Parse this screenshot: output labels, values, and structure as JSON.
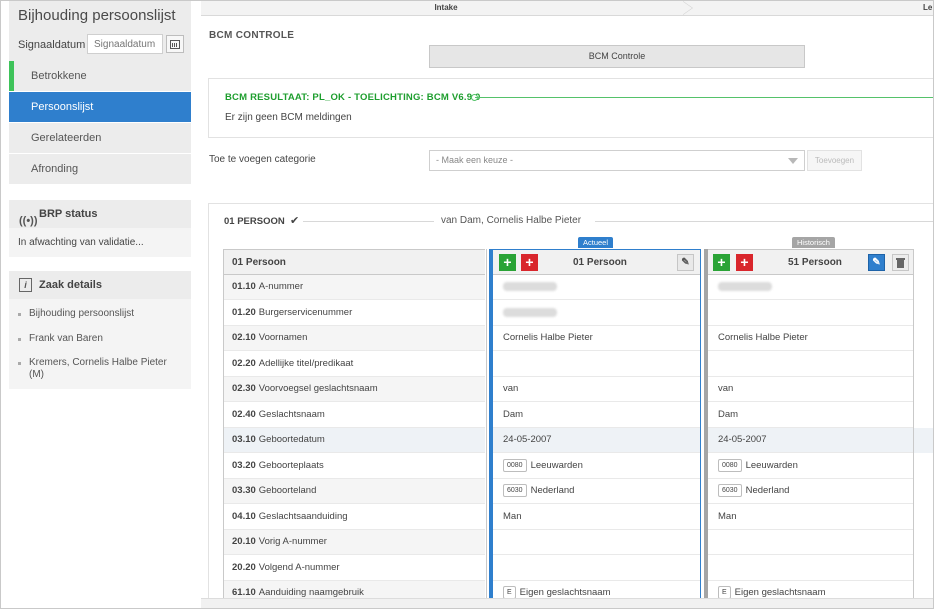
{
  "app": {
    "title": "Bijhouding persoonslijst"
  },
  "sidebar": {
    "signaaldatum_label": "Signaaldatum",
    "signaaldatum_placeholder": "Signaaldatum",
    "nav": [
      {
        "label": "Betrokkene",
        "state": "done"
      },
      {
        "label": "Persoonslijst",
        "state": "active"
      },
      {
        "label": "Gerelateerden",
        "state": "normal"
      },
      {
        "label": "Afronding",
        "state": "normal"
      }
    ],
    "brp": {
      "title": "BRP status",
      "text": "In afwachting van validatie..."
    },
    "zaak": {
      "title": "Zaak details",
      "items": [
        "Bijhouding persoonslijst",
        "Frank van Baren",
        "Kremers, Cornelis Halbe Pieter",
        "(M)"
      ]
    }
  },
  "steps": {
    "current": "Intake",
    "next": "Le"
  },
  "bcm": {
    "heading": "BCM CONTROLE",
    "button": "BCM Controle",
    "result_title": "BCM RESULTAAT: PL_OK - TOELICHTING: BCM V6.9.0",
    "result_text": "Er zijn geen BCM meldingen"
  },
  "category": {
    "label": "Toe te voegen categorie",
    "placeholder": "- Maak een keuze -",
    "add_button": "Toevoegen"
  },
  "persoon": {
    "title": "01 PERSOON",
    "name": "van Dam, Cornelis Halbe Pieter",
    "header_label": "01 Persoon",
    "actueel_tag": "Actueel",
    "actueel_header": "01 Persoon",
    "hist_tag": "Historisch",
    "hist_header": "51 Persoon",
    "rows": [
      {
        "code": "01.10",
        "label": "A-nummer",
        "act": "",
        "act_code": "",
        "hist": "",
        "hist_code": "",
        "redacted": true
      },
      {
        "code": "01.20",
        "label": "Burgerservicenummer",
        "act": "",
        "act_code": "",
        "hist": "",
        "hist_code": "",
        "redacted_act": true
      },
      {
        "code": "02.10",
        "label": "Voornamen",
        "act": "Cornelis Halbe Pieter",
        "act_code": "",
        "hist": "Cornelis Halbe Pieter",
        "hist_code": ""
      },
      {
        "code": "02.20",
        "label": "Adellijke titel/predikaat",
        "act": "",
        "act_code": "",
        "hist": "",
        "hist_code": ""
      },
      {
        "code": "02.30",
        "label": "Voorvoegsel geslachtsnaam",
        "act": "van",
        "act_code": "",
        "hist": "van",
        "hist_code": ""
      },
      {
        "code": "02.40",
        "label": "Geslachtsnaam",
        "act": "Dam",
        "act_code": "",
        "hist": "Dam",
        "hist_code": ""
      },
      {
        "code": "03.10",
        "label": "Geboortedatum",
        "act": "24-05-2007",
        "act_code": "",
        "hist": "24-05-2007",
        "hist_code": ""
      },
      {
        "code": "03.20",
        "label": "Geboorteplaats",
        "act": "Leeuwarden",
        "act_code": "0080",
        "hist": "Leeuwarden",
        "hist_code": "0080"
      },
      {
        "code": "03.30",
        "label": "Geboorteland",
        "act": "Nederland",
        "act_code": "6030",
        "hist": "Nederland",
        "hist_code": "6030"
      },
      {
        "code": "04.10",
        "label": "Geslachtsaanduiding",
        "act": "Man",
        "act_code": "",
        "hist": "Man",
        "hist_code": ""
      },
      {
        "code": "20.10",
        "label": "Vorig A-nummer",
        "act": "",
        "act_code": "",
        "hist": "",
        "hist_code": ""
      },
      {
        "code": "20.20",
        "label": "Volgend A-nummer",
        "act": "",
        "act_code": "",
        "hist": "",
        "hist_code": ""
      },
      {
        "code": "61.10",
        "label": "Aanduiding naamgebruik",
        "act": "Eigen geslachtsnaam",
        "act_code": "E",
        "hist": "Eigen geslachtsnaam",
        "hist_code": "E"
      }
    ]
  },
  "colors": {
    "accent": "#2f7fcd",
    "success": "#1e9e2e",
    "done_bar": "#3ec35a",
    "add": "#2aa336",
    "remove": "#d9262c",
    "historic": "#a5a5a5"
  }
}
